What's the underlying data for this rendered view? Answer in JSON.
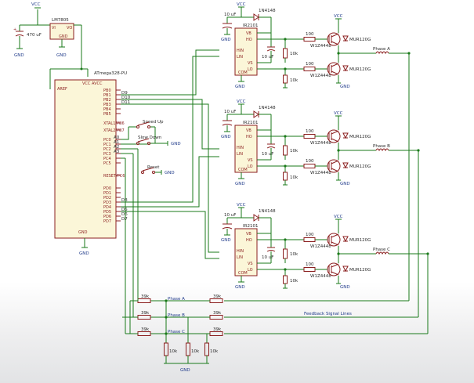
{
  "power": {
    "vcc": "VCC",
    "gnd": "GND"
  },
  "regulator": {
    "name": "LM7805",
    "cap": "470 uF"
  },
  "mcu": {
    "name": "ATmega328-PU",
    "pins_left": [
      "AREF"
    ],
    "pins_right": [
      "PB0",
      "PB1",
      "PB2",
      "PB3",
      "PB4",
      "PB5",
      "XTAL1/PB6",
      "XTAL2/PB7",
      "PC0",
      "PC1",
      "PC2",
      "PC3",
      "PC4",
      "PC5",
      "RESET/PC6",
      "PD0",
      "PD1",
      "PD2",
      "PD3",
      "PD4",
      "PD5",
      "PD6",
      "PD7"
    ],
    "signals": [
      "D9",
      "D10",
      "D11",
      "A0",
      "A1",
      "A2",
      "A3",
      "D3",
      "D5",
      "D6",
      "D7"
    ]
  },
  "switches": {
    "speed_up": "Speed Up",
    "slow_down": "Slow Down",
    "reset": "Reset"
  },
  "driver": {
    "ic": "IR2101",
    "diode": "1N4148",
    "bootstrap_cap": "10 uF",
    "decoupling_cap": "10 uF",
    "pulldown": "10k",
    "gate_resistor": "100",
    "zener": "W1Z4448",
    "mosfet_diode": "MUR120G",
    "pins": {
      "vb": "VB",
      "ho": "HO",
      "hin": "HIN",
      "lin": "LIN",
      "vs": "VS",
      "com": "COM",
      "lo": "LO",
      "vcc": "VCC"
    }
  },
  "phases": [
    "Phase A",
    "Phase B",
    "Phase C"
  ],
  "feedback": {
    "label": "Feedback Signal Lines",
    "r_series": "39k",
    "r_ground": "10k"
  }
}
